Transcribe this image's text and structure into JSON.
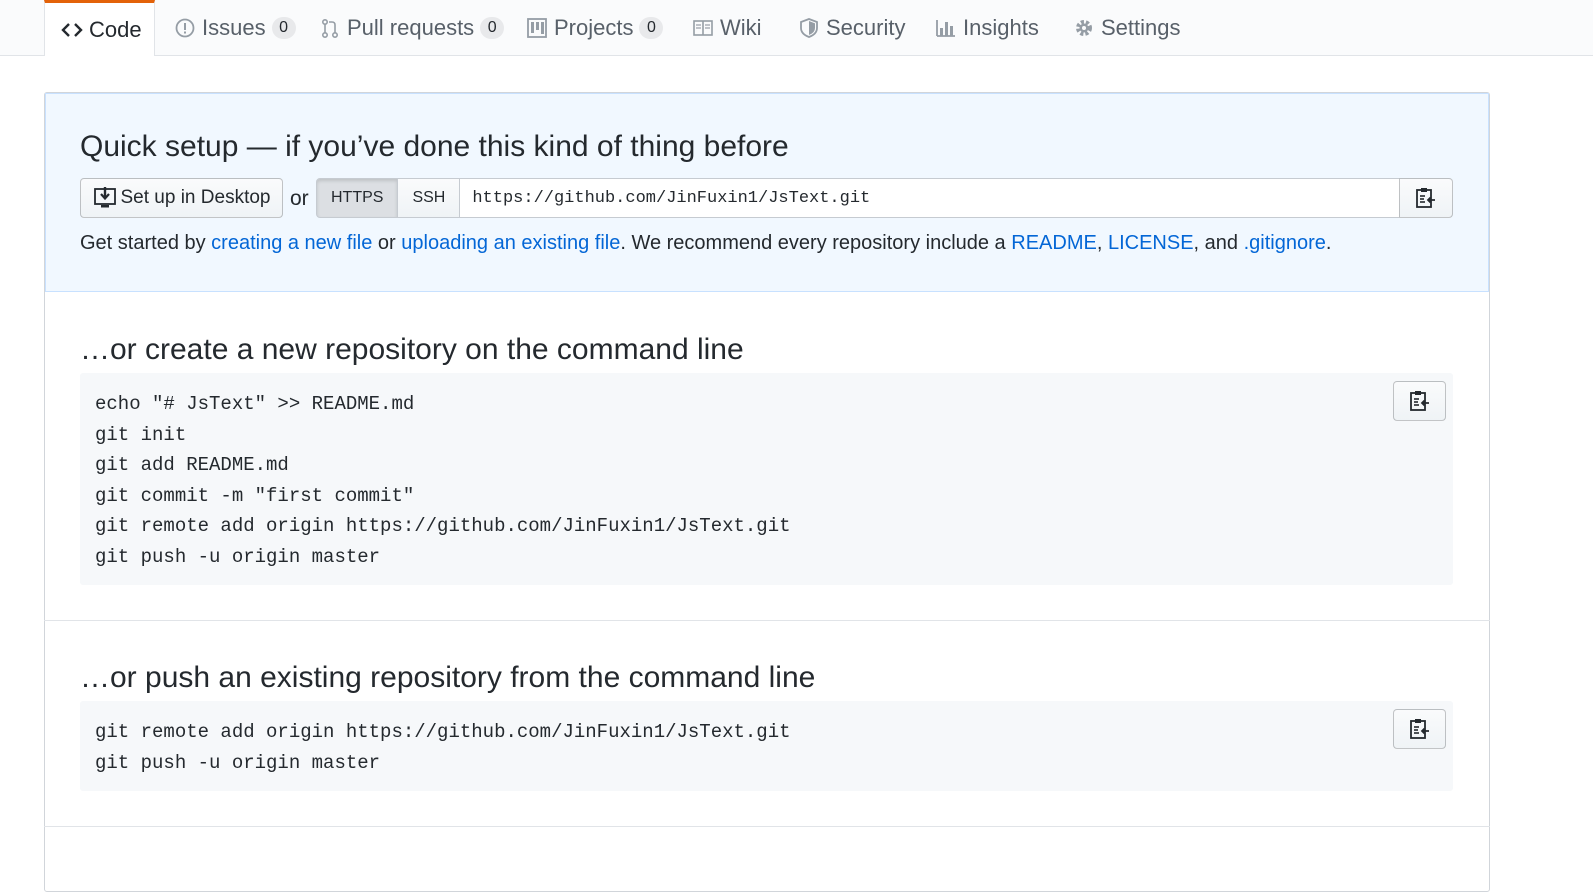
{
  "tabs": [
    {
      "label": "Code",
      "icon": "code-icon"
    },
    {
      "label": "Issues",
      "count": "0",
      "icon": "issue-opened-icon"
    },
    {
      "label": "Pull requests",
      "count": "0",
      "icon": "git-pull-request-icon"
    },
    {
      "label": "Projects",
      "count": "0",
      "icon": "project-icon"
    },
    {
      "label": "Wiki",
      "icon": "book-icon"
    },
    {
      "label": "Security",
      "icon": "shield-icon"
    },
    {
      "label": "Insights",
      "icon": "graph-icon"
    },
    {
      "label": "Settings",
      "icon": "gear-icon"
    }
  ],
  "quick_setup": {
    "title": "Quick setup — if you’ve done this kind of thing before",
    "desktop_button": "Set up in Desktop",
    "or": "or",
    "protocols": [
      "HTTPS",
      "SSH"
    ],
    "selected_protocol": "HTTPS",
    "clone_url": "https://github.com/JinFuxin1/JsText.git",
    "desc": {
      "prefix": "Get started by ",
      "link1": "creating a new file",
      "mid1": " or ",
      "link2": "uploading an existing file",
      "mid2": ". We recommend every repository include a ",
      "link3": "README",
      "sep1": ", ",
      "link4": "LICENSE",
      "sep2": ", and ",
      "link5": ".gitignore",
      "suffix": "."
    }
  },
  "new_repo": {
    "title": "…or create a new repository on the command line",
    "lines": [
      "echo \"# JsText\" >> README.md",
      "git init",
      "git add README.md",
      "git commit -m \"first commit\"",
      "git remote add origin https://github.com/JinFuxin1/JsText.git",
      "git push -u origin master"
    ]
  },
  "push_existing": {
    "title": "…or push an existing repository from the command line",
    "lines": [
      "git remote add origin https://github.com/JinFuxin1/JsText.git",
      "git push -u origin master"
    ]
  },
  "colors": {
    "link": "#0366d6",
    "tab_accent": "#e36209",
    "quick_bg": "#f1f8ff",
    "code_bg": "#f6f8fa"
  }
}
